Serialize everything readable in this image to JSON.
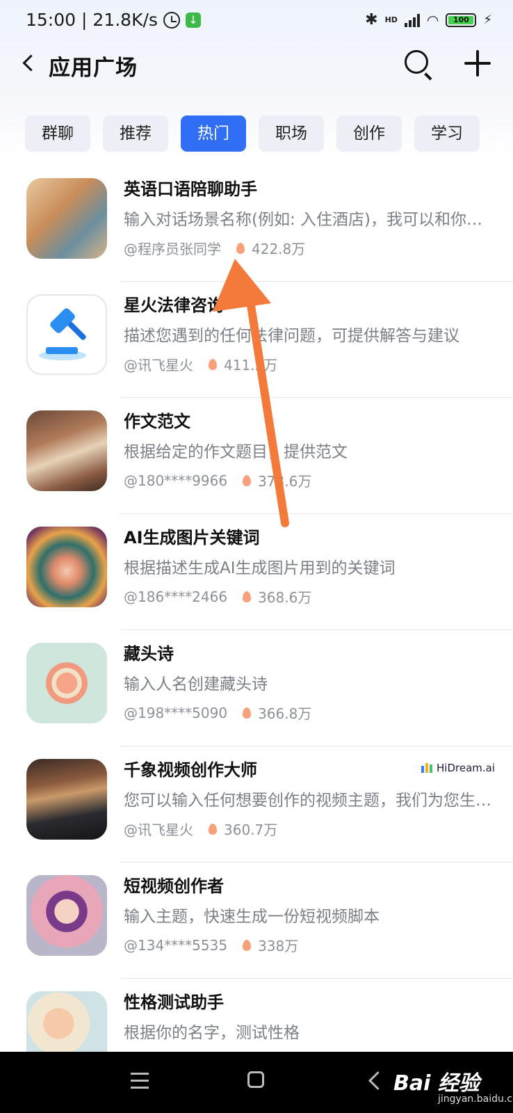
{
  "status_bar": {
    "time": "15:00",
    "network_speed": "| 21.8K/s",
    "battery_level": "100",
    "network_label": "HD",
    "icons": [
      "alarm-icon",
      "download-app-icon",
      "bluetooth-icon",
      "signal-icon",
      "wifi-icon",
      "battery-icon",
      "charging-icon"
    ]
  },
  "header": {
    "title": "应用广场"
  },
  "tabs": [
    {
      "label": "群聊",
      "active": false
    },
    {
      "label": "推荐",
      "active": false
    },
    {
      "label": "热门",
      "active": true
    },
    {
      "label": "职场",
      "active": false
    },
    {
      "label": "创作",
      "active": false
    },
    {
      "label": "学习",
      "active": false
    }
  ],
  "apps": [
    {
      "title": "英语口语陪聊助手",
      "desc": "输入对话场景名称(例如: 入住酒店)，我可以和你进行英语口语对话",
      "author": "@程序员张同学",
      "hot": "422.8万"
    },
    {
      "title": "星火法律咨询",
      "desc": "描述您遇到的任何法律问题，可提供解答与建议",
      "author": "@讯飞星火",
      "hot": "411.5万"
    },
    {
      "title": "作文范文",
      "desc": "根据给定的作文题目，提供范文",
      "author": "@180****9966",
      "hot": "373.6万"
    },
    {
      "title": "AI生成图片关键词",
      "desc": "根据描述生成AI生成图片用到的关键词",
      "author": "@186****2466",
      "hot": "368.6万"
    },
    {
      "title": "藏头诗",
      "desc": "输入人名创建藏头诗",
      "author": "@198****5090",
      "hot": "366.8万"
    },
    {
      "title": "千象视频创作大师",
      "desc": "您可以输入任何想要创作的视频主题，我们为您生成视频",
      "author": "@讯飞星火",
      "hot": "360.7万",
      "badge": "HiDream.ai"
    },
    {
      "title": "短视频创作者",
      "desc": "输入主题，快速生成一份短视频脚本",
      "author": "@134****5535",
      "hot": "338万"
    },
    {
      "title": "性格测试助手",
      "desc": "根据你的名字，测试性格",
      "author": "",
      "hot": ""
    }
  ],
  "nav_bar": {
    "watermark": "Bai 经验",
    "watermark_sub": "jingyan.baidu.com"
  },
  "colors": {
    "accent": "#2f6ef5",
    "annotation_arrow": "#f47a3c"
  }
}
